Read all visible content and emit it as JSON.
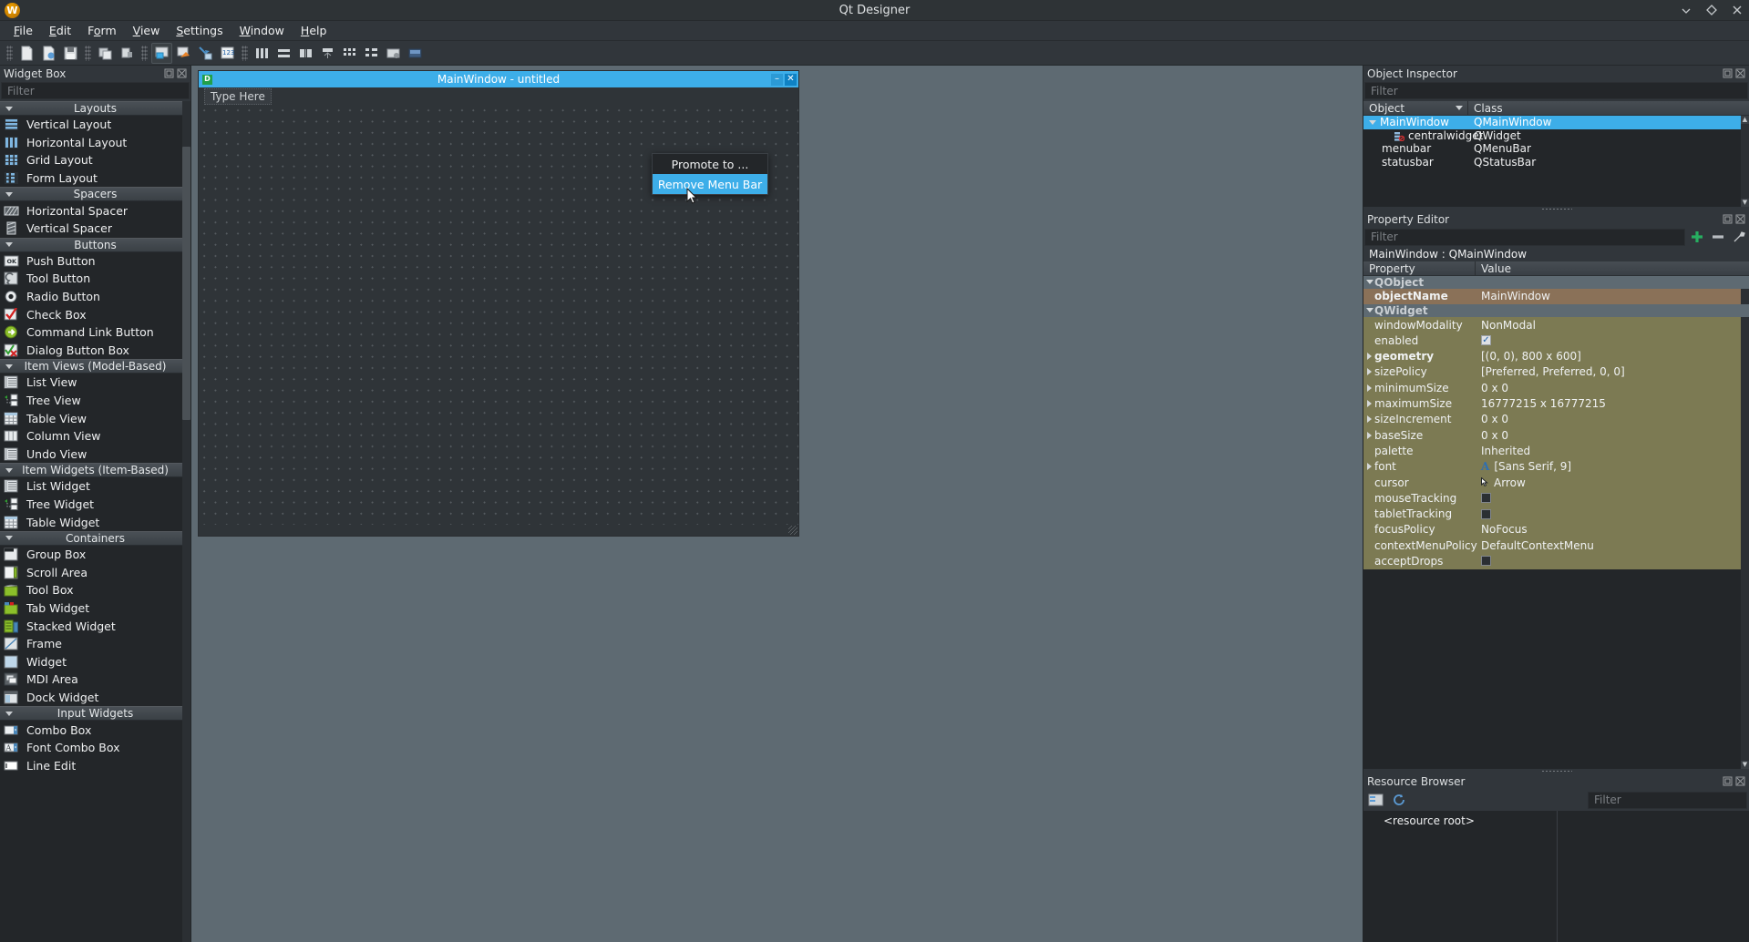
{
  "window": {
    "title": "Qt Designer",
    "logo_letter": "W",
    "buttons": [
      {
        "name": "minimize",
        "glyph": "⌄"
      },
      {
        "name": "maximize",
        "glyph": "◇"
      },
      {
        "name": "close",
        "glyph": "✕"
      }
    ]
  },
  "menubar": {
    "items": [
      {
        "label": "File",
        "accel": "F"
      },
      {
        "label": "Edit",
        "accel": "E"
      },
      {
        "label": "Form",
        "accel": "o"
      },
      {
        "label": "View",
        "accel": "V"
      },
      {
        "label": "Settings",
        "accel": "S"
      },
      {
        "label": "Window",
        "accel": "W"
      },
      {
        "label": "Help",
        "accel": "H"
      }
    ]
  },
  "toolbar": {
    "groups": [
      [
        "new-form",
        "open-form",
        "save-form"
      ],
      [
        "undo",
        "redo"
      ],
      [
        "edit-widgets",
        "edit-signals-slots",
        "edit-buddies",
        "edit-tab-order"
      ],
      [
        "layout-horizontally",
        "layout-vertically",
        "layout-splitter-horizontal",
        "layout-splitter-vertical",
        "layout-grid",
        "layout-form",
        "break-layout",
        "adjust-size"
      ]
    ]
  },
  "widget_box": {
    "title": "Widget Box",
    "filter_placeholder": "Filter",
    "categories": [
      {
        "name": "Layouts",
        "items": [
          {
            "label": "Vertical Layout",
            "icon": "vertical-layout-icon"
          },
          {
            "label": "Horizontal Layout",
            "icon": "horizontal-layout-icon"
          },
          {
            "label": "Grid Layout",
            "icon": "grid-layout-icon"
          },
          {
            "label": "Form Layout",
            "icon": "form-layout-icon"
          }
        ]
      },
      {
        "name": "Spacers",
        "items": [
          {
            "label": "Horizontal Spacer",
            "icon": "horizontal-spacer-icon"
          },
          {
            "label": "Vertical Spacer",
            "icon": "vertical-spacer-icon"
          }
        ]
      },
      {
        "name": "Buttons",
        "items": [
          {
            "label": "Push Button",
            "icon": "push-button-icon"
          },
          {
            "label": "Tool Button",
            "icon": "tool-button-icon"
          },
          {
            "label": "Radio Button",
            "icon": "radio-button-icon"
          },
          {
            "label": "Check Box",
            "icon": "check-box-icon"
          },
          {
            "label": "Command Link Button",
            "icon": "command-link-button-icon"
          },
          {
            "label": "Dialog Button Box",
            "icon": "dialog-button-box-icon"
          }
        ]
      },
      {
        "name": "Item Views (Model-Based)",
        "items": [
          {
            "label": "List View",
            "icon": "list-view-icon"
          },
          {
            "label": "Tree View",
            "icon": "tree-view-icon"
          },
          {
            "label": "Table View",
            "icon": "table-view-icon"
          },
          {
            "label": "Column View",
            "icon": "column-view-icon"
          },
          {
            "label": "Undo View",
            "icon": "undo-view-icon"
          }
        ]
      },
      {
        "name": "Item Widgets (Item-Based)",
        "items": [
          {
            "label": "List Widget",
            "icon": "list-widget-icon"
          },
          {
            "label": "Tree Widget",
            "icon": "tree-widget-icon"
          },
          {
            "label": "Table Widget",
            "icon": "table-widget-icon"
          }
        ]
      },
      {
        "name": "Containers",
        "items": [
          {
            "label": "Group Box",
            "icon": "group-box-icon"
          },
          {
            "label": "Scroll Area",
            "icon": "scroll-area-icon"
          },
          {
            "label": "Tool Box",
            "icon": "tool-box-icon"
          },
          {
            "label": "Tab Widget",
            "icon": "tab-widget-icon"
          },
          {
            "label": "Stacked Widget",
            "icon": "stacked-widget-icon"
          },
          {
            "label": "Frame",
            "icon": "frame-icon"
          },
          {
            "label": "Widget",
            "icon": "widget-icon"
          },
          {
            "label": "MDI Area",
            "icon": "mdi-area-icon"
          },
          {
            "label": "Dock Widget",
            "icon": "dock-widget-icon"
          }
        ]
      },
      {
        "name": "Input Widgets",
        "items": [
          {
            "label": "Combo Box",
            "icon": "combo-box-icon"
          },
          {
            "label": "Font Combo Box",
            "icon": "font-combo-box-icon"
          },
          {
            "label": "Line Edit",
            "icon": "line-edit-icon"
          }
        ]
      }
    ]
  },
  "form_window": {
    "title": "MainWindow - untitled",
    "icon_letter": "D",
    "type_here": "Type Here",
    "window_buttons": [
      {
        "name": "minimize",
        "glyph": "–"
      },
      {
        "name": "close",
        "glyph": "✕"
      }
    ]
  },
  "context_menu": {
    "items": [
      {
        "label": "Promote to ...",
        "selected": false
      },
      {
        "label": "Remove Menu Bar",
        "selected": true
      }
    ]
  },
  "object_inspector": {
    "title": "Object Inspector",
    "filter_placeholder": "Filter",
    "columns": [
      "Object",
      "Class"
    ],
    "rows": [
      {
        "object": "MainWindow",
        "class": "QMainWindow",
        "indent": 0,
        "selected": true,
        "expander": true
      },
      {
        "object": "centralwidget",
        "class": "QWidget",
        "indent": 2,
        "selected": false,
        "expander": false
      },
      {
        "object": "menubar",
        "class": "QMenuBar",
        "indent": 1,
        "selected": false,
        "expander": false
      },
      {
        "object": "statusbar",
        "class": "QStatusBar",
        "indent": 1,
        "selected": false,
        "expander": false
      }
    ]
  },
  "property_editor": {
    "title": "Property Editor",
    "filter_placeholder": "Filter",
    "object_header": "MainWindow : QMainWindow",
    "columns": [
      "Property",
      "Value"
    ],
    "buttons": [
      "add-property",
      "remove-property",
      "configure"
    ],
    "rows": [
      {
        "kind": "group",
        "name": "QObject"
      },
      {
        "kind": "prop",
        "name": "objectName",
        "value": "MainWindow",
        "tone": "tan",
        "bold": true,
        "expander": false
      },
      {
        "kind": "group",
        "name": "QWidget"
      },
      {
        "kind": "prop",
        "name": "windowModality",
        "value": "NonModal",
        "tone": "olive",
        "bold": false,
        "expander": false
      },
      {
        "kind": "prop",
        "name": "enabled",
        "value": "",
        "tone": "olive",
        "bold": false,
        "expander": false,
        "widget": "checkbox-checked"
      },
      {
        "kind": "prop",
        "name": "geometry",
        "value": "[(0, 0), 800 x 600]",
        "tone": "olive",
        "bold": true,
        "expander": true
      },
      {
        "kind": "prop",
        "name": "sizePolicy",
        "value": "[Preferred, Preferred, 0, 0]",
        "tone": "olive",
        "bold": false,
        "expander": true
      },
      {
        "kind": "prop",
        "name": "minimumSize",
        "value": "0 x 0",
        "tone": "olive",
        "bold": false,
        "expander": true
      },
      {
        "kind": "prop",
        "name": "maximumSize",
        "value": "16777215 x 16777215",
        "tone": "olive",
        "bold": false,
        "expander": true
      },
      {
        "kind": "prop",
        "name": "sizeIncrement",
        "value": "0 x 0",
        "tone": "olive",
        "bold": false,
        "expander": true
      },
      {
        "kind": "prop",
        "name": "baseSize",
        "value": "0 x 0",
        "tone": "olive",
        "bold": false,
        "expander": true
      },
      {
        "kind": "prop",
        "name": "palette",
        "value": "Inherited",
        "tone": "olive",
        "bold": false,
        "expander": false
      },
      {
        "kind": "prop",
        "name": "font",
        "value": "[Sans Serif, 9]",
        "tone": "olive",
        "bold": false,
        "expander": true,
        "widget": "font-badge"
      },
      {
        "kind": "prop",
        "name": "cursor",
        "value": "Arrow",
        "tone": "olive",
        "bold": false,
        "expander": false,
        "widget": "cursor-badge"
      },
      {
        "kind": "prop",
        "name": "mouseTracking",
        "value": "",
        "tone": "olive",
        "bold": false,
        "expander": false,
        "widget": "checkbox-empty"
      },
      {
        "kind": "prop",
        "name": "tabletTracking",
        "value": "",
        "tone": "olive",
        "bold": false,
        "expander": false,
        "widget": "checkbox-empty"
      },
      {
        "kind": "prop",
        "name": "focusPolicy",
        "value": "NoFocus",
        "tone": "olive",
        "bold": false,
        "expander": false
      },
      {
        "kind": "prop",
        "name": "contextMenuPolicy",
        "value": "DefaultContextMenu",
        "tone": "olive",
        "bold": false,
        "expander": false
      },
      {
        "kind": "prop",
        "name": "acceptDrops",
        "value": "",
        "tone": "olive",
        "bold": false,
        "expander": false,
        "widget": "checkbox-empty"
      }
    ]
  },
  "resource_browser": {
    "title": "Resource Browser",
    "filter_placeholder": "Filter",
    "buttons": [
      "edit-resources",
      "reload"
    ],
    "root_label": "<resource root>"
  },
  "colors": {
    "accent": "#3daee9",
    "panel_bg": "#31363b",
    "list_bg": "#232629",
    "canvas_bg": "#5e6a72",
    "tan": "#8a7158",
    "olive": "#7c7a53"
  }
}
